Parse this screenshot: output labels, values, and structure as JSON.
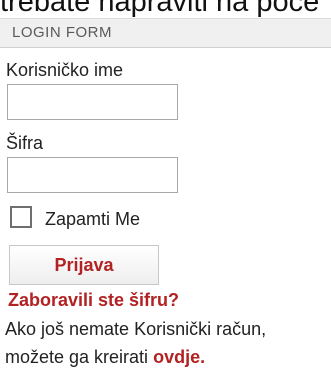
{
  "page_top_text": "trebate napraviti na poče",
  "login_form": {
    "title": "LOGIN FORM",
    "username_label": "Korisničko ime",
    "username_value": "",
    "password_label": "Šifra",
    "password_value": "",
    "remember_label": "Zapamti Me",
    "remember_checked": false,
    "submit_label": "Prijava",
    "forgot_link": "Zaboravili ste šifru?",
    "no_account_text": "Ako još nemate Korisnički račun,",
    "create_text": "možete ga kreirati",
    "create_link": "ovdje",
    "create_suffix": ".",
    "accent_color": "#b22222"
  }
}
